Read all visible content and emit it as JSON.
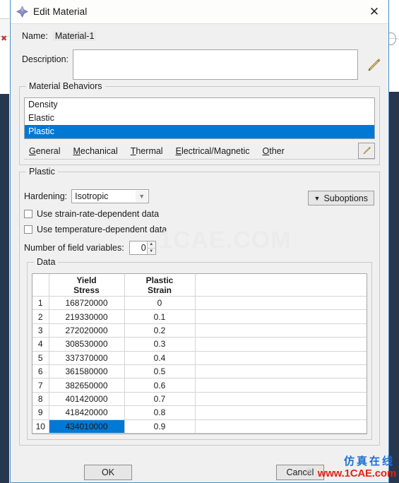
{
  "window": {
    "title": "Edit Material",
    "icon": "abaqus-material-icon",
    "close_label": "✕"
  },
  "name_row": {
    "label": "Name:",
    "value": "Material-1"
  },
  "description_row": {
    "label": "Description:",
    "value": "",
    "edit_icon": "pencil-icon"
  },
  "material_behaviors": {
    "group_title": "Material Behaviors",
    "items": [
      {
        "label": "Density",
        "selected": false
      },
      {
        "label": "Elastic",
        "selected": false
      },
      {
        "label": "Plastic",
        "selected": true
      }
    ],
    "tabs": [
      {
        "accel": "G",
        "rest": "eneral"
      },
      {
        "accel": "M",
        "rest": "echanical"
      },
      {
        "accel": "T",
        "rest": "hermal"
      },
      {
        "accel": "E",
        "rest": "lectrical/Magnetic"
      },
      {
        "accel": "O",
        "rest": "ther"
      }
    ],
    "tab_edit_icon": "pencil-icon"
  },
  "plastic": {
    "group_title": "Plastic",
    "hardening_label": "Hardening:",
    "hardening_value": "Isotropic",
    "suboptions_label": "Suboptions",
    "suboptions_caret": "▼",
    "checkboxes": [
      {
        "label": "Use strain-rate-dependent data",
        "checked": false
      },
      {
        "label": "Use temperature-dependent data",
        "checked": false
      }
    ],
    "field_vars_label": "Number of field variables:",
    "field_vars_value": "0"
  },
  "data_table": {
    "group_title": "Data",
    "columns": [
      "",
      "Yield\nStress",
      "Plastic\nStrain"
    ],
    "column_headers": [
      {
        "line1": "Yield",
        "line2": "Stress"
      },
      {
        "line1": "Plastic",
        "line2": "Strain"
      }
    ],
    "rows": [
      {
        "index": "1",
        "yield_stress": "168720000",
        "plastic_strain": "0",
        "selected": false
      },
      {
        "index": "2",
        "yield_stress": "219330000",
        "plastic_strain": "0.1",
        "selected": false
      },
      {
        "index": "3",
        "yield_stress": "272020000",
        "plastic_strain": "0.2",
        "selected": false
      },
      {
        "index": "4",
        "yield_stress": "308530000",
        "plastic_strain": "0.3",
        "selected": false
      },
      {
        "index": "5",
        "yield_stress": "337370000",
        "plastic_strain": "0.4",
        "selected": false
      },
      {
        "index": "6",
        "yield_stress": "361580000",
        "plastic_strain": "0.5",
        "selected": false
      },
      {
        "index": "7",
        "yield_stress": "382650000",
        "plastic_strain": "0.6",
        "selected": false
      },
      {
        "index": "8",
        "yield_stress": "401420000",
        "plastic_strain": "0.7",
        "selected": false
      },
      {
        "index": "9",
        "yield_stress": "418420000",
        "plastic_strain": "0.8",
        "selected": false
      },
      {
        "index": "10",
        "yield_stress": "434010000",
        "plastic_strain": "0.9",
        "selected": true
      }
    ],
    "scroll_up": "▲",
    "scroll_down": "▼"
  },
  "footer": {
    "ok_label": "OK",
    "cancel_label": "Cancel"
  },
  "watermarks": {
    "center": "1CAE.COM",
    "chinese": "仿真在线",
    "url": "www.1CAE.com"
  },
  "colors": {
    "selection_blue": "#0078d4",
    "dialog_bg": "#f0f0f0",
    "border_blue": "#4a90c4",
    "watermark_blue": "#1f6fd0",
    "watermark_red": "#e2231a"
  }
}
